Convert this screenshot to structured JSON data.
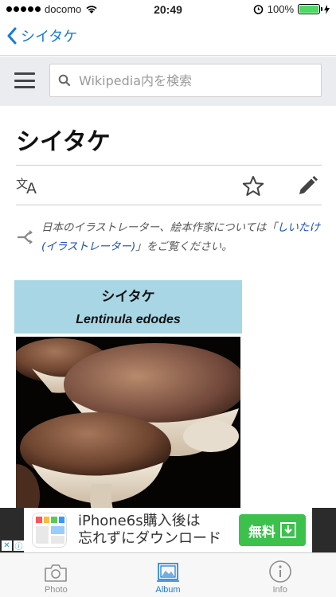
{
  "status": {
    "carrier": "docomo",
    "time": "20:49",
    "battery": "100%"
  },
  "nav": {
    "back_label": "シイタケ"
  },
  "search": {
    "placeholder": "Wikipedia内を検索"
  },
  "article": {
    "title": "シイタケ",
    "hatnote_prefix": "日本のイラストレーター、絵本作家については「",
    "hatnote_link": "しいたけ (イラストレーター)",
    "hatnote_suffix": "」をご覧ください。"
  },
  "infobox": {
    "name": "シイタケ",
    "scientific_name": "Lentinula edodes"
  },
  "ad": {
    "line1": "iPhone6s購入後は",
    "line2": "忘れずにダウンロード",
    "button_label": "無料"
  },
  "tabs": [
    {
      "label": "Photo"
    },
    {
      "label": "Album"
    },
    {
      "label": "Info"
    }
  ],
  "colors": {
    "accent": "#1a7bd8",
    "infobox_header": "#a9d6e5",
    "ad_button": "#3cc14d"
  }
}
